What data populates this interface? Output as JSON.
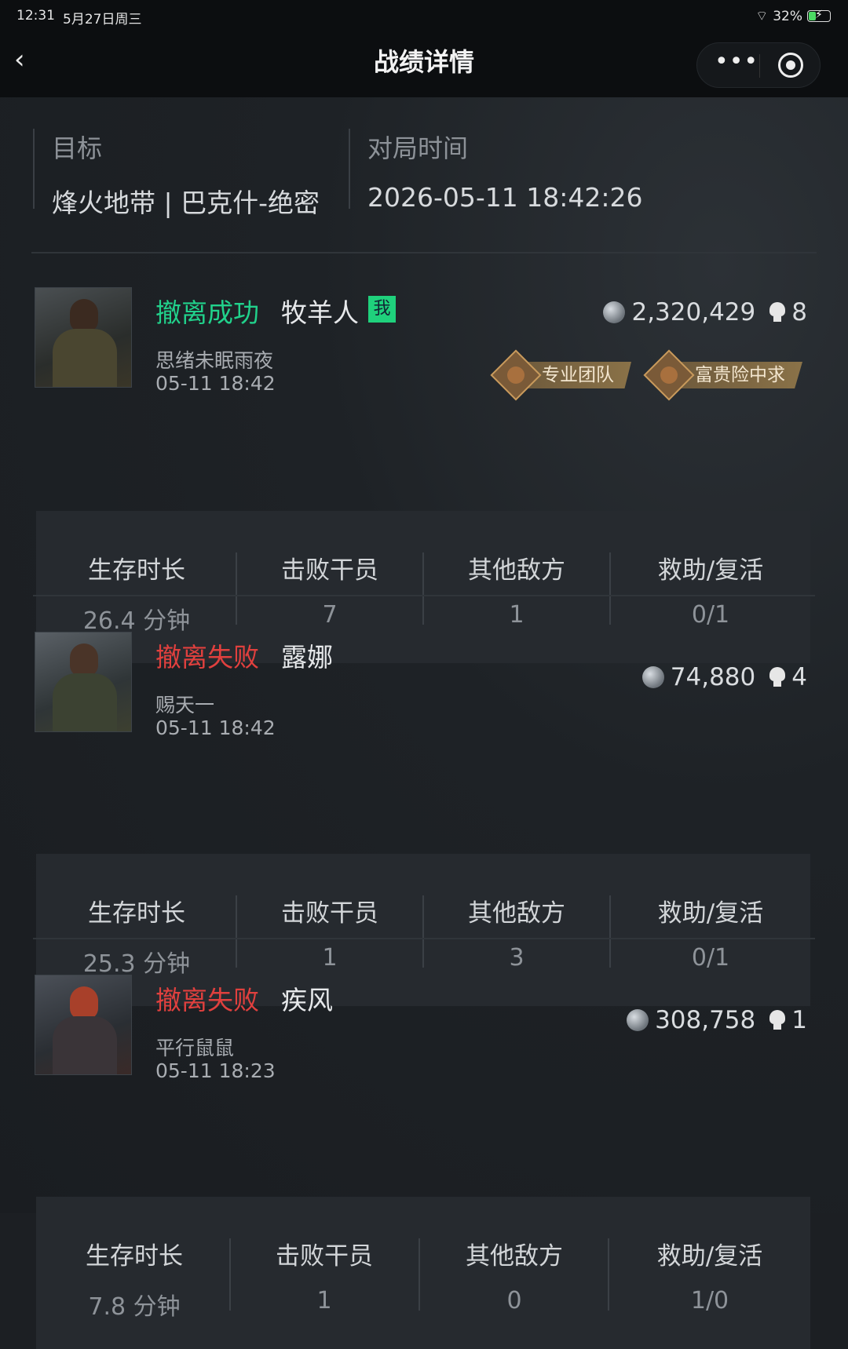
{
  "status_bar": {
    "time": "12:31",
    "date": "5月27日周三",
    "battery": "32%"
  },
  "nav": {
    "back_icon": "chevron-left-icon",
    "title": "战绩详情",
    "more_icon": "more-dots-icon",
    "close_icon": "target-icon"
  },
  "header": {
    "target_label": "目标",
    "target_value": "烽火地带 | 巴克什-绝密",
    "time_label": "对局时间",
    "time_value": "2026-05-11 18:42:26"
  },
  "stat_labels": {
    "survival": "生存时长",
    "kills": "击败干员",
    "other": "其他敌方",
    "assist": "救助/复活"
  },
  "matches": [
    {
      "status": "撤离成功",
      "status_type": "success",
      "hero": "牧羊人",
      "me_tag": "我",
      "player": "思绪未眠雨夜",
      "time": "05-11 18:42",
      "money": "2,320,429",
      "kills_icon_count": "8",
      "badges": [
        "专业团队",
        "富贵险中求"
      ],
      "survival": "26.4 分钟",
      "kills": "7",
      "other": "1",
      "assist": "0/1"
    },
    {
      "status": "撤离失败",
      "status_type": "fail",
      "hero": "露娜",
      "player": "赐天一",
      "time": "05-11 18:42",
      "money": "74,880",
      "kills_icon_count": "4",
      "survival": "25.3 分钟",
      "kills": "1",
      "other": "3",
      "assist": "0/1"
    },
    {
      "status": "撤离失败",
      "status_type": "fail",
      "hero": "疾风",
      "player": "平行鼠鼠",
      "time": "05-11 18:23",
      "money": "308,758",
      "kills_icon_count": "1",
      "survival": "7.8 分钟",
      "kills": "1",
      "other": "0",
      "assist": "1/0"
    }
  ],
  "colors": {
    "success": "#21d18b",
    "fail": "#e0403e",
    "me_tag": "#1fd17c"
  }
}
